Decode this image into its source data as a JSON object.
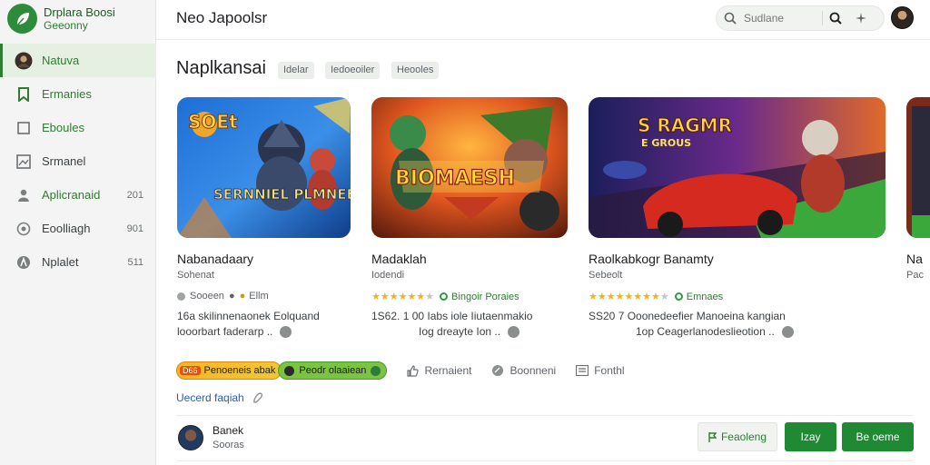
{
  "brand": {
    "title": "Drplara Boosi",
    "subtitle": "Geeonny"
  },
  "sidebar": {
    "items": [
      {
        "label": "Natuva",
        "count": "",
        "icon": "avatar-icon",
        "active": true
      },
      {
        "label": "Ermanies",
        "count": "",
        "icon": "bookmark-icon",
        "active": false
      },
      {
        "label": "Eboules",
        "count": "",
        "icon": "square-icon",
        "active": false
      },
      {
        "label": "Srmanel",
        "count": "",
        "icon": "image-icon",
        "active": false
      },
      {
        "label": "Aplicranaid",
        "count": "201",
        "icon": "person-icon",
        "active": false
      },
      {
        "label": "Eoolliagh",
        "count": "901",
        "icon": "circle-icon",
        "active": false
      },
      {
        "label": "Nplalet",
        "count": "511",
        "icon": "figure-icon",
        "active": false
      }
    ]
  },
  "header": {
    "title": "Neo Japoolsr",
    "search_placeholder": "Sudlane"
  },
  "main": {
    "section_title": "Naplkansai",
    "chips": [
      "Idelar",
      "Iedoeoiler",
      "Heooles"
    ],
    "cards": [
      {
        "art_text_top": "SOEt",
        "art_text_main": "SERNNIEL PLMNEE",
        "name": "Nabanadaary",
        "sub": "Sohenat",
        "meta_prefix": "Sooeen",
        "meta_suffix": "Ellm",
        "rating": 0,
        "badge": "",
        "desc_line1": "16a  skilinnenaonek Eolquand",
        "desc_line2": "looorbart faderarp  .."
      },
      {
        "art_text_top": "",
        "art_text_main": "BIOMAESH",
        "name": "Madaklah",
        "sub": "Iodendi",
        "meta_prefix": "",
        "meta_suffix": "",
        "rating": 6,
        "badge": "Bingoir Poraies",
        "desc_line1": "1S62. 1 00 Iabs iole Iiutaenmakio",
        "desc_line2": "Iog dreayte Ion  .."
      },
      {
        "art_text_top": "S RAGMR",
        "art_text_main": "E GROUS",
        "name": "Raolkabkogr Banamty",
        "sub": "Sebeolt",
        "meta_prefix": "",
        "meta_suffix": "",
        "rating": 8,
        "badge": "Emnaes",
        "desc_line1": "SS20  7  Ooonedeefier Manoeina kangian",
        "desc_line2": "1op Ceagerlanodeslieotion  .."
      },
      {
        "art_text_top": "",
        "art_text_main": "",
        "name": "Na",
        "sub": "Pac",
        "meta_prefix": "",
        "meta_suffix": "",
        "rating": 0,
        "badge": "",
        "desc_line1": "",
        "desc_line2": ""
      }
    ],
    "pills": {
      "orange_tag": "D66",
      "orange_label": "Penoeneis abak",
      "green_label": "Peodr olaaiean"
    },
    "actions": [
      "Rernaient",
      "Boonneni",
      "Fonthl"
    ],
    "link": "Uecerd faqiah"
  },
  "footer": {
    "user_name": "Banek",
    "user_sub": "Sooras",
    "btn_secondary": "Feaoleng",
    "btn_primary1": "Izay",
    "btn_primary2": "Be oeme"
  },
  "colors": {
    "accent": "#1f8a33",
    "star": "#f2b01e",
    "sidebar_bg": "#f3f4f3"
  }
}
